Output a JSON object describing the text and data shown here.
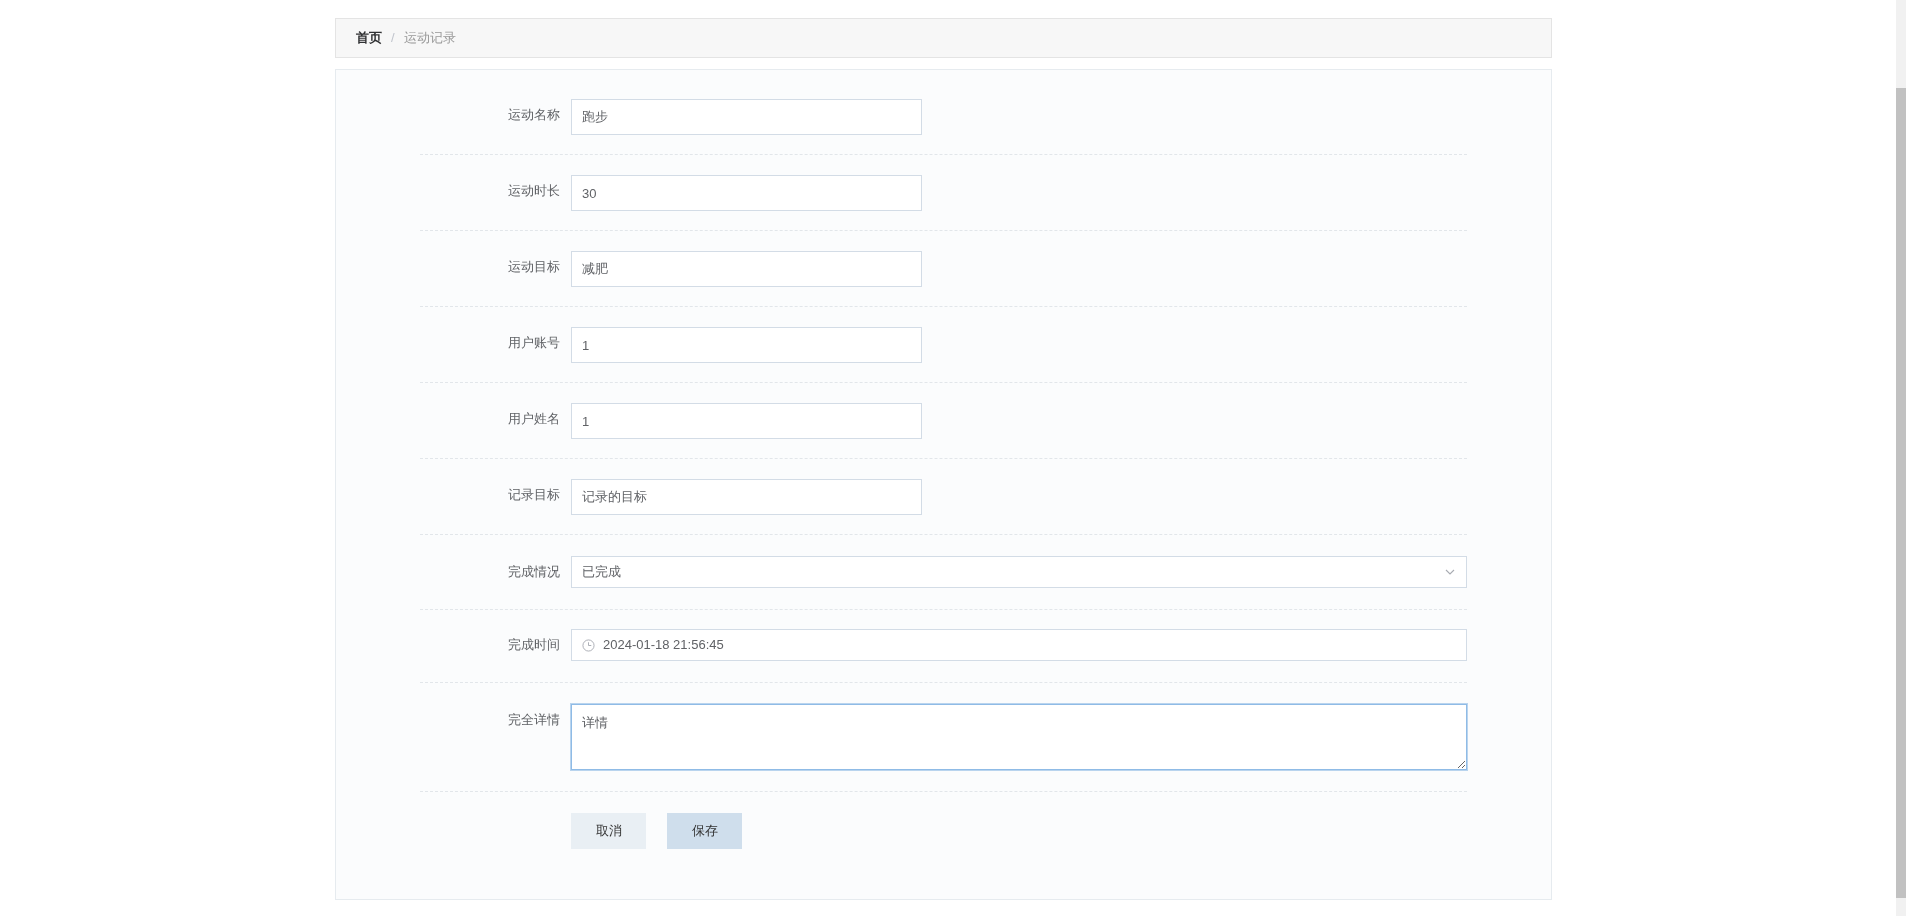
{
  "breadcrumb_separator": "/",
  "breadcrumb": [
    {
      "label": "首页",
      "current": false
    },
    {
      "label": "运动记录",
      "current": true
    }
  ],
  "fields": [
    {
      "kind": "text",
      "label": "运动名称",
      "value": "跑步"
    },
    {
      "kind": "text",
      "label": "运动时长",
      "value": "30"
    },
    {
      "kind": "text",
      "label": "运动目标",
      "value": "减肥"
    },
    {
      "kind": "text",
      "label": "用户账号",
      "value": "1"
    },
    {
      "kind": "text",
      "label": "用户姓名",
      "value": "1"
    },
    {
      "kind": "text",
      "label": "记录目标",
      "value": "记录的目标"
    },
    {
      "kind": "select",
      "label": "完成情况",
      "value": "已完成"
    },
    {
      "kind": "datetime",
      "label": "完成时间",
      "value": "2024-01-18 21:56:45"
    },
    {
      "kind": "textarea",
      "label": "完全详情",
      "value": "详情",
      "focused": true
    }
  ],
  "buttons": [
    {
      "label": "取消",
      "kind": "cancel"
    },
    {
      "label": "保存",
      "kind": "save"
    }
  ]
}
